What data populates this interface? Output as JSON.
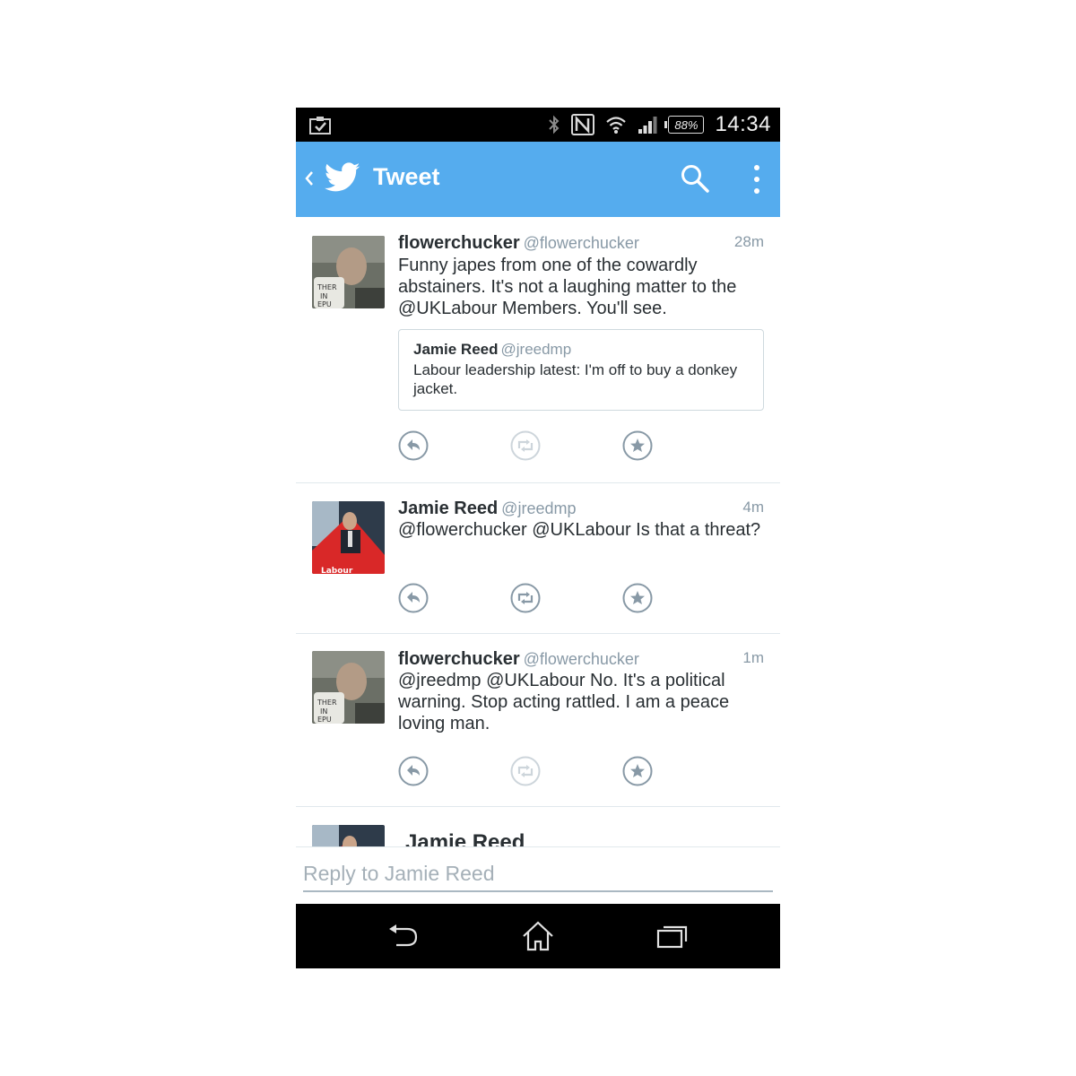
{
  "status_bar": {
    "battery": "88%",
    "time": "14:34",
    "icons": [
      "clipboard-check-icon",
      "bluetooth-icon",
      "nfc-icon",
      "wifi-icon",
      "signal-icon",
      "battery-icon"
    ]
  },
  "action_bar": {
    "title": "Tweet",
    "icons": [
      "back-chevron-icon",
      "twitter-bird-icon",
      "search-icon",
      "overflow-menu-icon"
    ],
    "color": "#55acee"
  },
  "tweets": [
    {
      "name": "flowerchucker",
      "handle": "@flowerchucker",
      "time": "28m",
      "text": "Funny japes from one of the cowardly abstainers. It's not a laughing matter to the @UKLabour Members. You'll see.",
      "quote": {
        "name": "Jamie Reed",
        "handle": "@jreedmp",
        "text": "Labour leadership latest: I'm off to buy a donkey jacket."
      },
      "retweet_enabled": false
    },
    {
      "name": "Jamie Reed",
      "handle": "@jreedmp",
      "time": "4m",
      "text": "@flowerchucker @UKLabour Is that a threat?",
      "retweet_enabled": true
    },
    {
      "name": "flowerchucker",
      "handle": "@flowerchucker",
      "time": "1m",
      "text": "@jreedmp @UKLabour No. It's a political warning. Stop acting rattled. I am a peace loving man.",
      "retweet_enabled": false
    },
    {
      "name": "Jamie Reed"
    }
  ],
  "reply": {
    "placeholder": "Reply to Jamie Reed"
  },
  "nav_bar": {
    "icons": [
      "back-icon",
      "home-icon",
      "recent-apps-icon"
    ]
  }
}
